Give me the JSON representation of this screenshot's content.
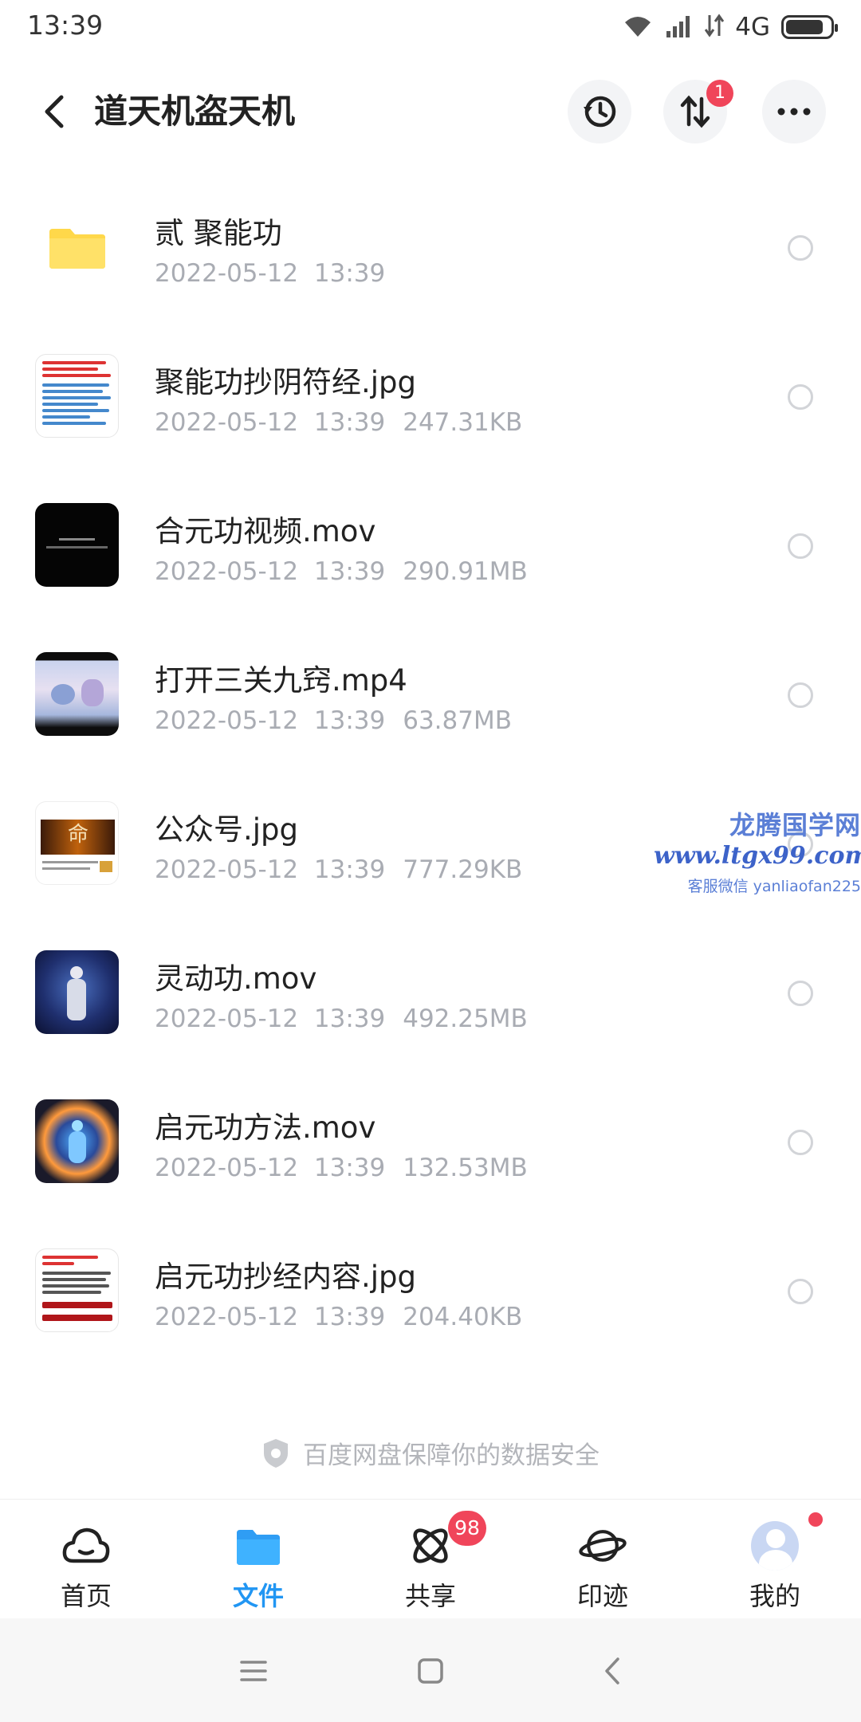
{
  "status_bar": {
    "time": "13:39",
    "network": "4G",
    "battery_level": 0.85
  },
  "header": {
    "title": "道天机盗天机",
    "transfer_badge": "1"
  },
  "files": [
    {
      "name": "贰 聚能功",
      "date": "2022-05-12",
      "time": "13:39",
      "size": "",
      "type": "folder"
    },
    {
      "name": "聚能功抄阴符经.jpg",
      "date": "2022-05-12",
      "time": "13:39",
      "size": "247.31KB",
      "type": "doc"
    },
    {
      "name": "合元功视频.mov",
      "date": "2022-05-12",
      "time": "13:39",
      "size": "290.91MB",
      "type": "black"
    },
    {
      "name": "打开三关九窍.mp4",
      "date": "2022-05-12",
      "time": "13:39",
      "size": "63.87MB",
      "type": "paint"
    },
    {
      "name": "公众号.jpg",
      "date": "2022-05-12",
      "time": "13:39",
      "size": "777.29KB",
      "type": "poster"
    },
    {
      "name": "灵动功.mov",
      "date": "2022-05-12",
      "time": "13:39",
      "size": "492.25MB",
      "type": "blue"
    },
    {
      "name": "启元功方法.mov",
      "date": "2022-05-12",
      "time": "13:39",
      "size": "132.53MB",
      "type": "aura"
    },
    {
      "name": "启元功抄经内容.jpg",
      "date": "2022-05-12",
      "time": "13:39",
      "size": "204.40KB",
      "type": "doc2"
    }
  ],
  "watermark": {
    "line1": "龙腾国学网",
    "line2": "www.ltgx99.com",
    "line3": "客服微信 yanliaofan225"
  },
  "safety_note": "百度网盘保障你的数据安全",
  "bottom_nav": {
    "home": "首页",
    "files": "文件",
    "share": "共享",
    "share_badge": "98",
    "traces": "印迹",
    "mine": "我的"
  },
  "colors": {
    "accent": "#2196f3",
    "badge": "#f0455a",
    "folder": "#ffd84a",
    "meta_text": "#a9acb3"
  }
}
